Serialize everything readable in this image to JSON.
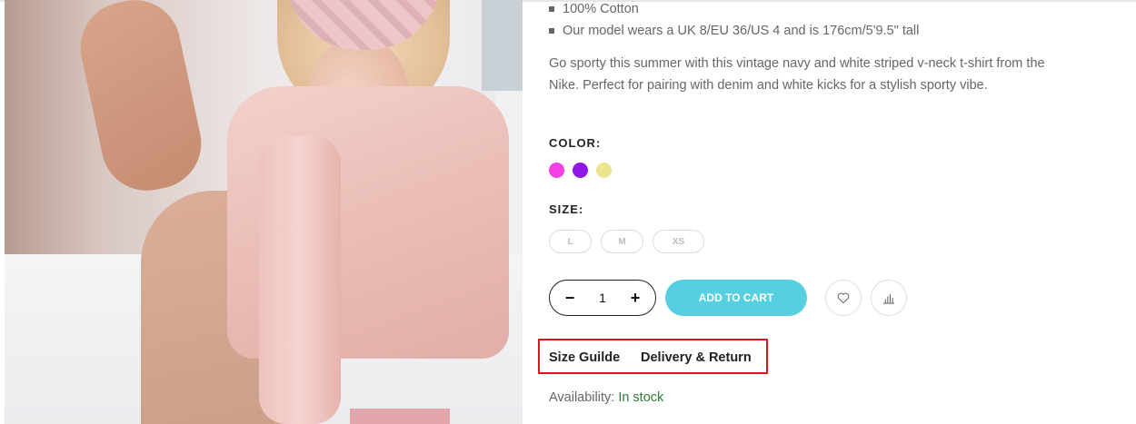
{
  "product": {
    "bullets": [
      "100% Cotton",
      "Our model wears a UK 8/EU 36/US 4 and is 176cm/5'9.5\" tall"
    ],
    "description": "Go sporty this summer with this vintage navy and white striped v-neck t-shirt from the Nike. Perfect for pairing with denim and white kicks for a stylish sporty vibe.",
    "color_label": "COLOR:",
    "colors": [
      "#f43fe6",
      "#8f17e6",
      "#ece58f"
    ],
    "size_label": "SIZE:",
    "sizes": [
      "L",
      "M",
      "XS"
    ],
    "quantity": {
      "minus": "−",
      "value": "1",
      "plus": "+"
    },
    "add_to_cart_label": "ADD TO CART",
    "links": {
      "size_guide": "Size Guilde",
      "delivery_return": "Delivery & Return"
    },
    "availability": {
      "label": "Availability:",
      "value": "In stock"
    }
  },
  "colors": {
    "accent": "#56cfe1",
    "stock": "#2f7d32",
    "highlight_box": "#d9151b"
  },
  "icons": [
    "heart-icon",
    "compare-chart-icon"
  ]
}
